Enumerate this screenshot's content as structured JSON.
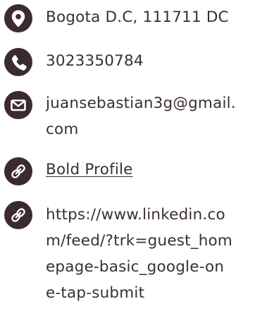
{
  "contact": {
    "address": "Bogota D.C, 111711 DC",
    "phone": "3023350784",
    "email_lines": [
      "juansebastian3g@gmail.",
      "com"
    ],
    "profile_link": "Bold Profile",
    "linkedin_lines": [
      "https://www.linkedin.co",
      "m/feed/?trk=guest_hom",
      "epage-basic_google-on",
      "e-tap-submit"
    ]
  },
  "icons": {
    "address": "location-pin-icon",
    "phone": "phone-icon",
    "email": "envelope-icon",
    "profile": "link-icon",
    "linkedin": "link-icon"
  },
  "colors": {
    "icon_background": "#3b2a2f",
    "icon_glyph": "#ffffff",
    "text": "#3a2f33"
  }
}
